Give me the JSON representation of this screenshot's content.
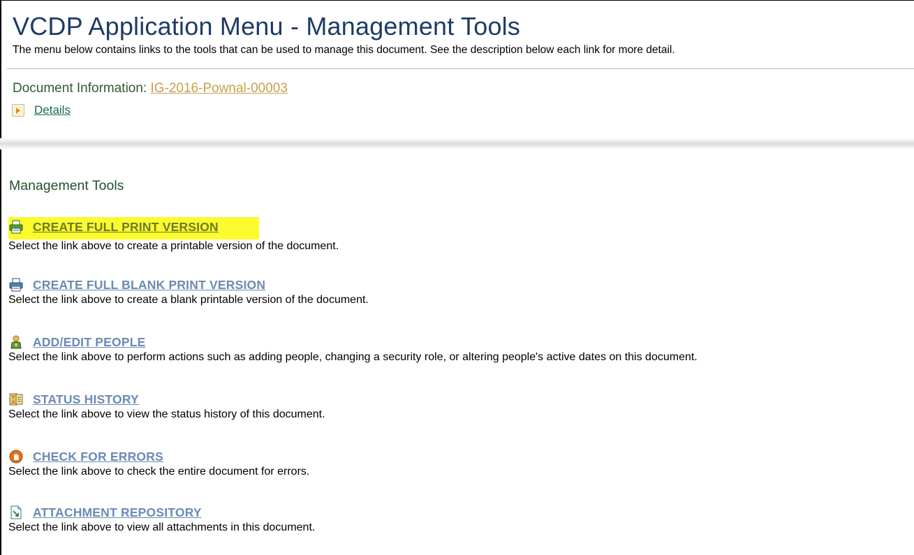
{
  "header": {
    "title": "VCDP Application Menu - Management Tools",
    "subtitle": "The menu below contains links to the tools that can be used to manage this document. See the description below each link for more detail."
  },
  "document": {
    "label": "Document Information: ",
    "id": "IG-2016-Pownal-00003",
    "details_label": "Details"
  },
  "section_title": "Management Tools",
  "tools": [
    {
      "icon": "printer-green-icon",
      "label": "CREATE FULL PRINT VERSION",
      "desc": "Select the link above to create a printable version of the document.",
      "highlighted": true
    },
    {
      "icon": "printer-blue-icon",
      "label": "CREATE FULL BLANK PRINT VERSION",
      "desc": "Select the link above to create a blank printable version of the document.",
      "highlighted": false
    },
    {
      "icon": "person-icon",
      "label": "ADD/EDIT PEOPLE",
      "desc": "Select the link above to perform actions such as adding people, changing a security role, or altering people's active dates on this document.",
      "highlighted": false
    },
    {
      "icon": "hourglass-history-icon",
      "label": "STATUS HISTORY",
      "desc": "Select the link above to view the status history of this document.",
      "highlighted": false
    },
    {
      "icon": "stop-hand-icon",
      "label": "CHECK FOR ERRORS",
      "desc": "Select the link above to check the entire document for errors.",
      "highlighted": false
    },
    {
      "icon": "attachment-document-icon",
      "label": "ATTACHMENT REPOSITORY",
      "desc": "Select the link above to view all attachments in this document.",
      "highlighted": false
    }
  ],
  "colors": {
    "title": "#1d3b66",
    "link": "#6b8ab5",
    "highlight": "#fbfb2e",
    "doc_link": "#c9a04a"
  }
}
